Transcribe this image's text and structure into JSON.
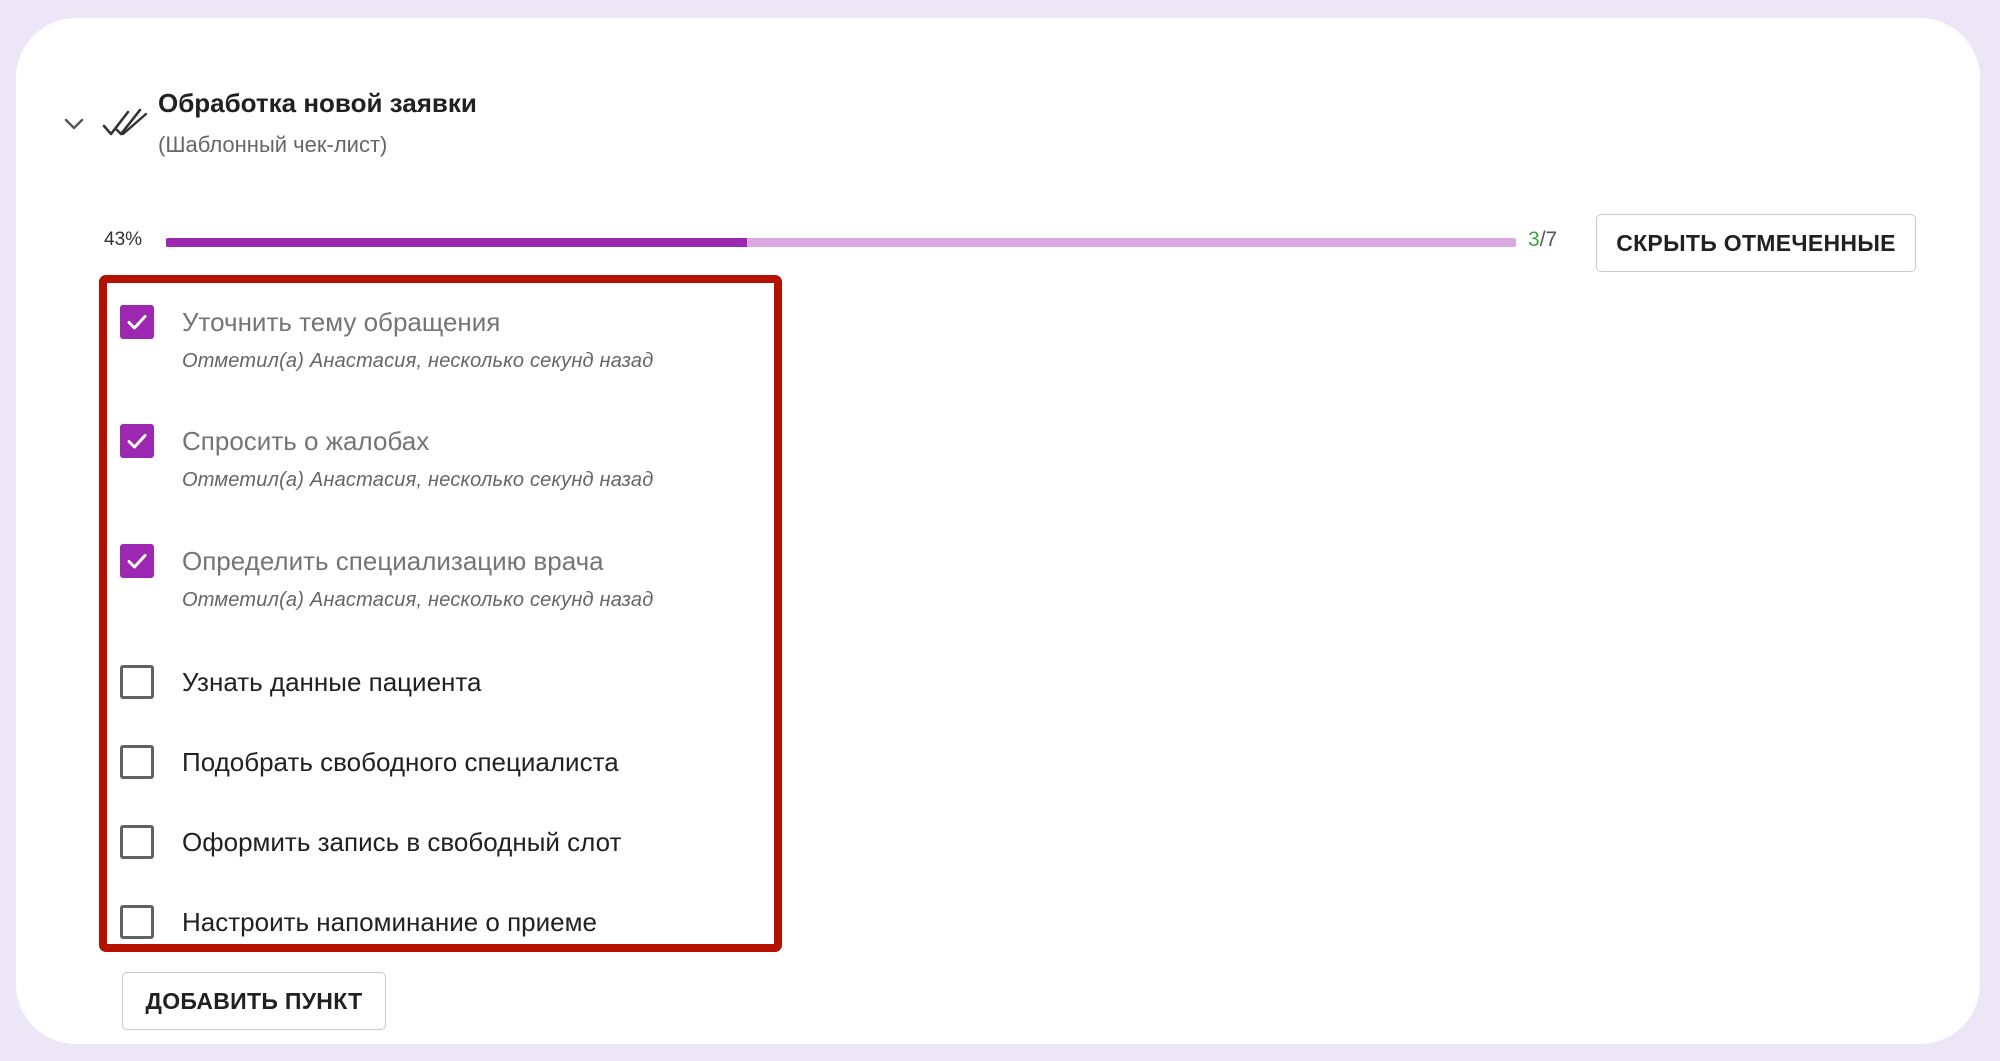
{
  "checklist": {
    "title": "Обработка новой заявки",
    "subtitle": "(Шаблонный чек-лист)",
    "icons": {
      "collapse": "chevron-down-icon",
      "status": "double-check-icon"
    },
    "progress": {
      "percent_label": "43%",
      "fraction": 0.43,
      "done": "3",
      "separator": "/",
      "total": "7"
    },
    "hide_checked_label": "СКРЫТЬ ОТМЕЧЕННЫЕ",
    "add_item_label": "ДОБАВИТЬ ПУНКТ",
    "items": [
      {
        "label": "Уточнить тему обращения",
        "checked": true,
        "note": "Отметил(а) Анастасия, несколько секунд назад"
      },
      {
        "label": "Спросить о жалобах",
        "checked": true,
        "note": "Отметил(а) Анастасия, несколько секунд назад"
      },
      {
        "label": "Определить специализацию врача",
        "checked": true,
        "note": "Отметил(а) Анастасия, несколько секунд назад"
      },
      {
        "label": "Узнать данные пациента",
        "checked": false
      },
      {
        "label": "Подобрать свободного специалиста",
        "checked": false
      },
      {
        "label": "Оформить запись в свободный слот",
        "checked": false
      },
      {
        "label": "Настроить напоминание о приеме",
        "checked": false
      }
    ]
  },
  "colors": {
    "accent": "#9c27b0",
    "progress_track": "#d9a8e0",
    "done_count": "#43a047",
    "highlight_border": "#b41100",
    "page_background": "#ece6f7"
  }
}
